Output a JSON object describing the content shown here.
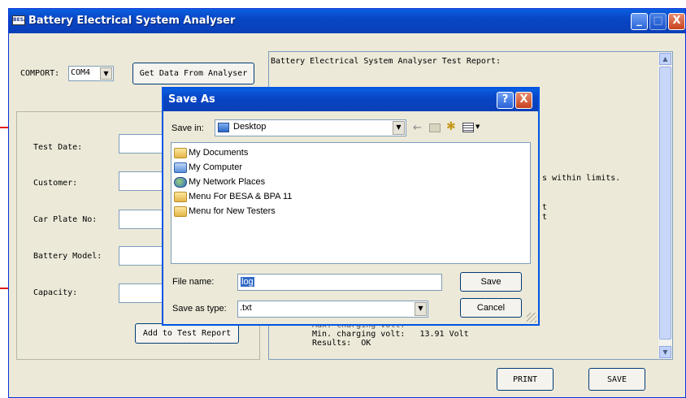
{
  "main_window": {
    "title": "Battery Electrical System Analyser",
    "icon_text": "BESA",
    "minimize": "_",
    "maximize": "□",
    "close": "X"
  },
  "comport": {
    "label": "COMPORT:",
    "value": "COM4"
  },
  "get_data_button": "Get Data From Analyser",
  "form": {
    "test_date_label": "Test Date:",
    "customer_label": "Customer:",
    "car_plate_label": "Car Plate No:",
    "battery_model_label": "Battery Model:",
    "capacity_label": "Capacity:",
    "add_button": "Add to Test Report"
  },
  "report": {
    "header": "Battery Electrical System Analyser Test Report:",
    "fragment_limits": "s within limits.",
    "fragment_t1": "t",
    "fragment_t2": "t",
    "line_max_partial": "Max. charging volt:",
    "line_min": "Min. charging volt:   13.91 Volt",
    "line_results": "Results:  OK"
  },
  "bottom_buttons": {
    "print": "PRINT",
    "save": "SAVE"
  },
  "save_dialog": {
    "title": "Save As",
    "help": "?",
    "close": "X",
    "save_in_label": "Save in:",
    "save_in_value": "Desktop",
    "items": [
      {
        "label": "My Documents",
        "icon": "folder-icon"
      },
      {
        "label": "My Computer",
        "icon": "computer-icon"
      },
      {
        "label": "My Network Places",
        "icon": "network-places-icon"
      },
      {
        "label": "Menu For BESA & BPA 11",
        "icon": "folder-icon"
      },
      {
        "label": "Menu for New Testers",
        "icon": "folder-icon"
      }
    ],
    "file_name_label": "File name:",
    "file_name_value": "log",
    "save_as_type_label": "Save as type:",
    "save_as_type_value": ".txt",
    "save_button": "Save",
    "cancel_button": "Cancel"
  },
  "colors": {
    "title_bar": "#0846c4",
    "window_bg": "#ece9d8",
    "annotation_line": "#e11e1e",
    "selection": "#316ac5"
  }
}
